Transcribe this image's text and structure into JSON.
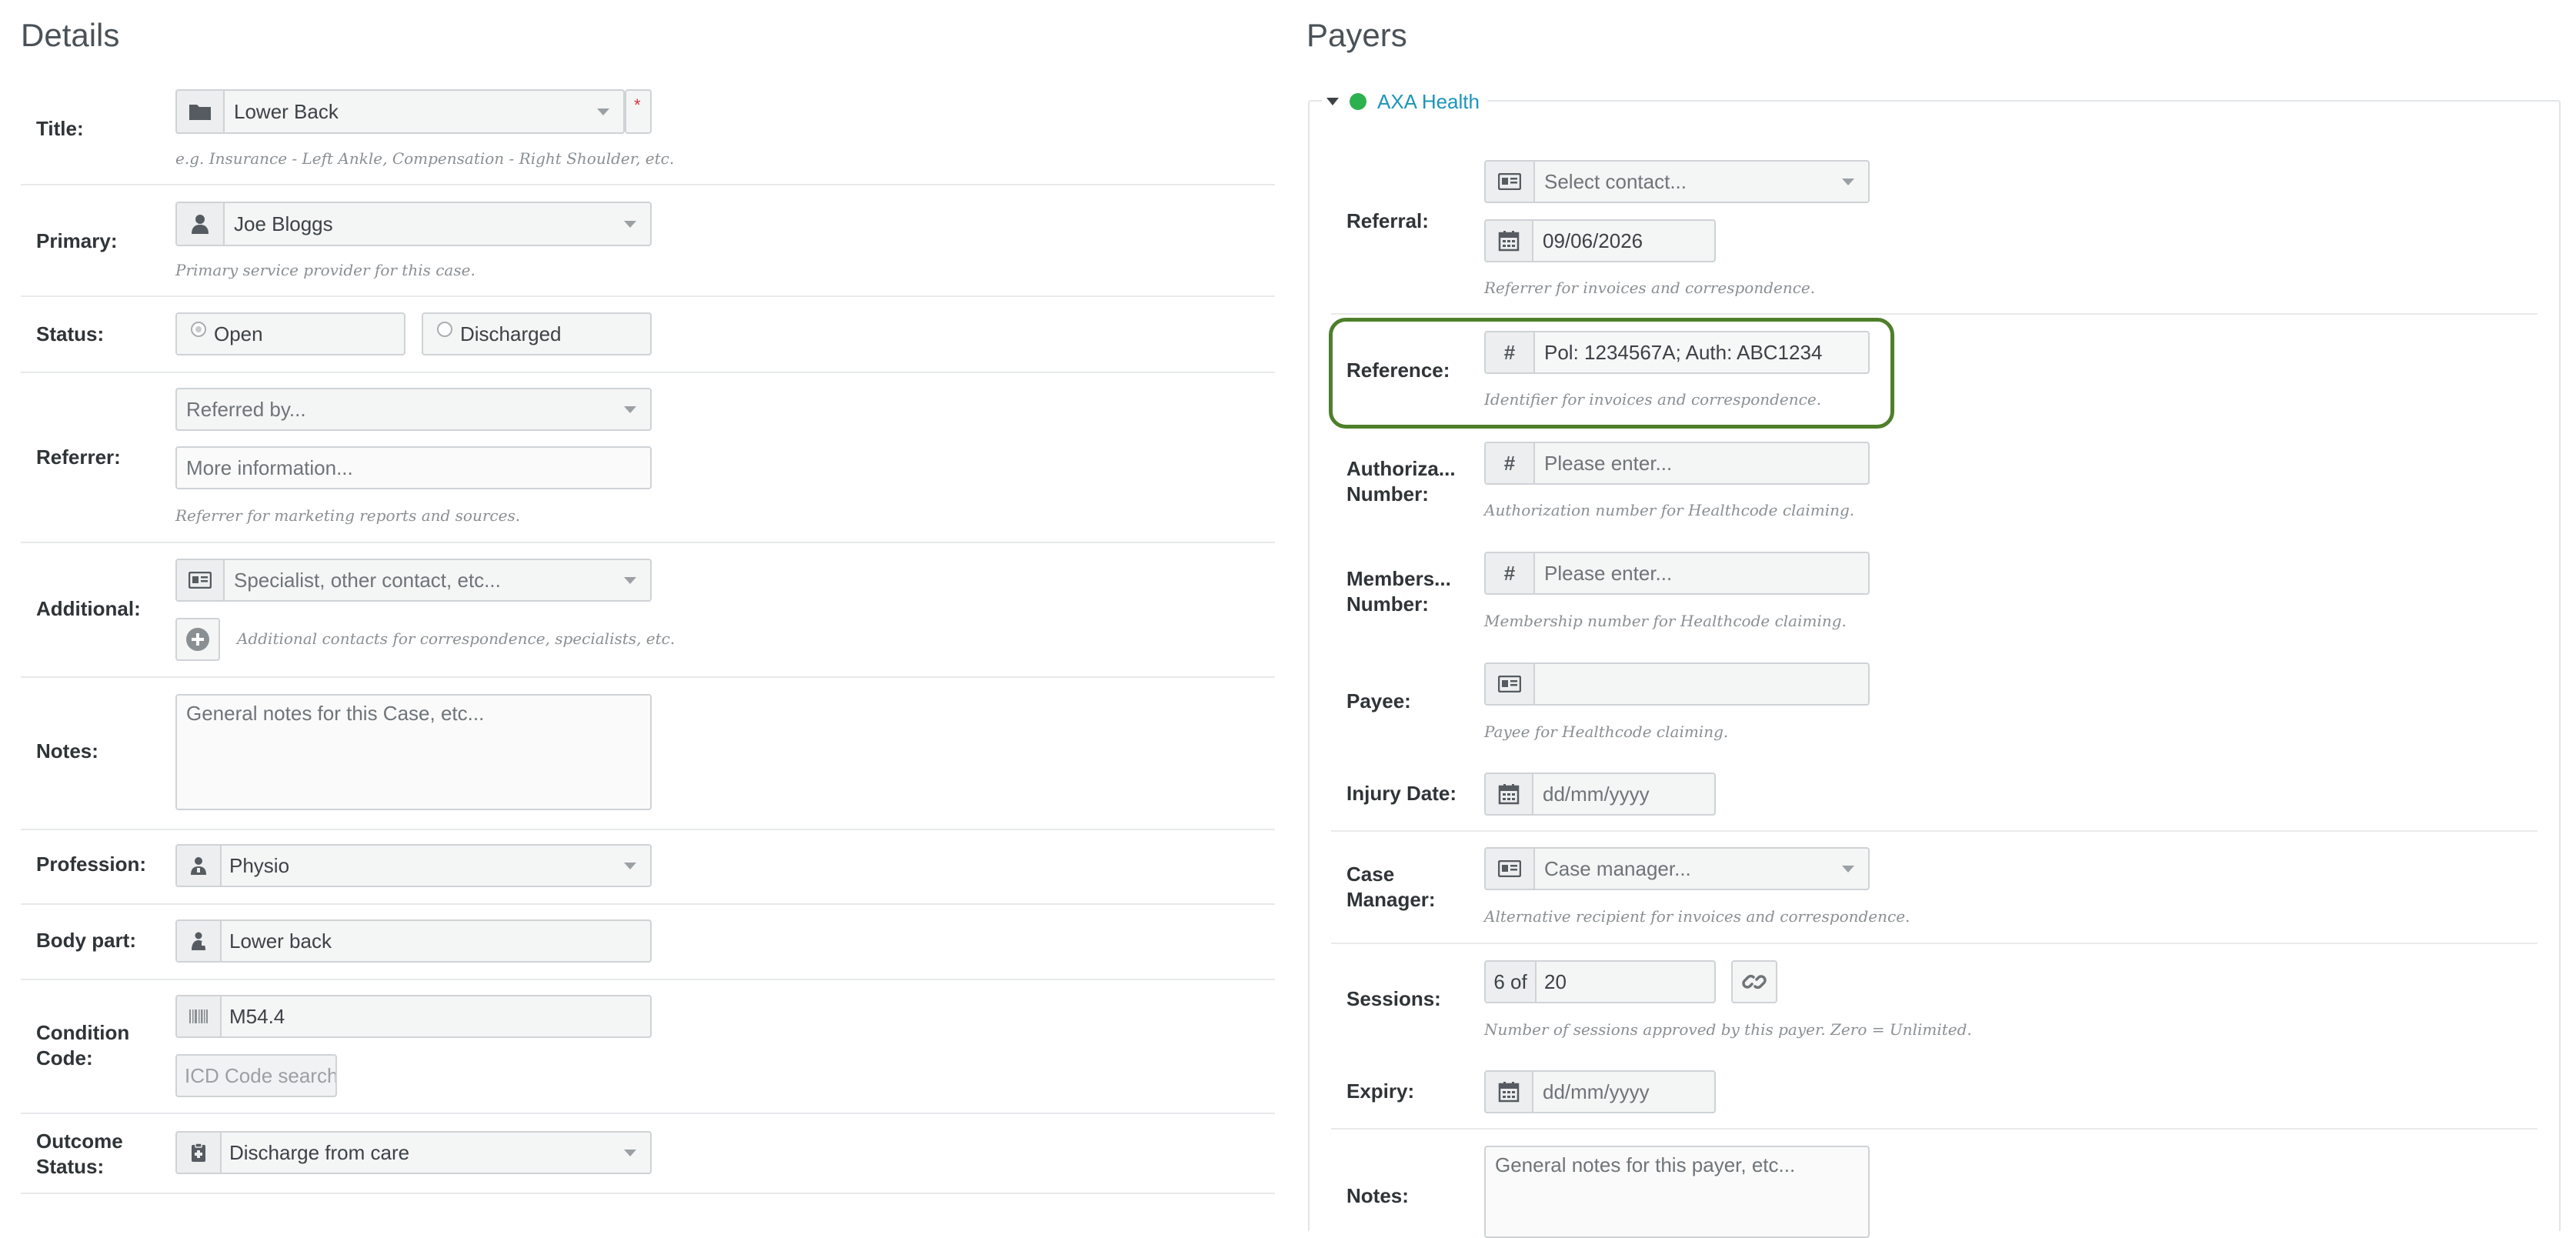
{
  "details": {
    "heading": "Details",
    "title": {
      "label": "Title:",
      "value": "Lower Back",
      "required_mark": "*",
      "help": "e.g. Insurance - Left Ankle, Compensation - Right Shoulder, etc."
    },
    "primary": {
      "label": "Primary:",
      "value": "Joe Bloggs",
      "help": "Primary service provider for this case."
    },
    "status": {
      "label": "Status:",
      "option_open": "Open",
      "option_discharged": "Discharged",
      "selected": "Open"
    },
    "referrer": {
      "label": "Referrer:",
      "select_placeholder": "Referred by...",
      "info_placeholder": "More information...",
      "help": "Referrer for marketing reports and sources."
    },
    "additional": {
      "label": "Additional:",
      "placeholder": "Specialist, other contact, etc...",
      "help": "Additional contacts for correspondence, specialists, etc."
    },
    "notes": {
      "label": "Notes:",
      "placeholder": "General notes for this Case, etc..."
    },
    "profession": {
      "label": "Profession:",
      "value": "Physio"
    },
    "body_part": {
      "label": "Body part:",
      "value": "Lower back"
    },
    "condition_code": {
      "label_line1": "Condition",
      "label_line2": "Code:",
      "value": "M54.4",
      "search_button": "ICD Code search"
    },
    "outcome_status": {
      "label_line1": "Outcome",
      "label_line2": "Status:",
      "value": "Discharge from care"
    }
  },
  "payers": {
    "heading": "Payers",
    "payer_name": "AXA Health",
    "status_color": "#2db14f",
    "referral": {
      "label": "Referral:",
      "contact_placeholder": "Select contact...",
      "date": "09/06/2026",
      "help": "Referrer for invoices and correspondence."
    },
    "reference": {
      "label": "Reference:",
      "value": "Pol: 1234567A;  Auth: ABC1234",
      "help": "Identifier for invoices and correspondence.",
      "highlight_color": "#4e7f2a"
    },
    "authorization": {
      "label_line1": "Authoriza...",
      "label_line2": "Number:",
      "placeholder": "Please enter...",
      "help": "Authorization number for Healthcode claiming."
    },
    "membership": {
      "label_line1": "Members...",
      "label_line2": "Number:",
      "placeholder": "Please enter...",
      "help": "Membership number for Healthcode claiming."
    },
    "payee": {
      "label": "Payee:",
      "value": "",
      "help": "Payee for Healthcode claiming."
    },
    "injury_date": {
      "label": "Injury Date:",
      "placeholder": "dd/mm/yyyy"
    },
    "case_manager": {
      "label_line1": "Case",
      "label_line2": "Manager:",
      "placeholder": "Case manager...",
      "help": "Alternative recipient for invoices and correspondence."
    },
    "sessions": {
      "label": "Sessions:",
      "prefix": "6 of",
      "value": "20",
      "help": "Number of sessions approved by this payer. Zero = Unlimited."
    },
    "expiry": {
      "label": "Expiry:",
      "placeholder": "dd/mm/yyyy"
    },
    "notes": {
      "label": "Notes:",
      "placeholder": "General notes for this payer, etc..."
    }
  },
  "icons": [
    "folder-icon",
    "user-icon",
    "contact-card-icon",
    "plus-circle-icon",
    "profession-icon",
    "body-part-icon",
    "barcode-icon",
    "clipboard-icon",
    "calendar-icon",
    "hash-icon",
    "link-icon",
    "caret-down-icon"
  ]
}
